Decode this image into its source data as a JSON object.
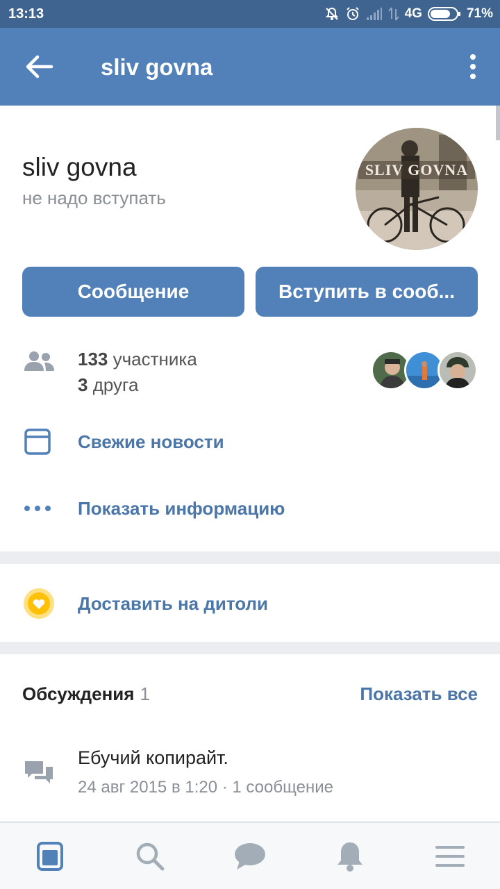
{
  "status_bar": {
    "time": "13:13",
    "network": "4G",
    "battery": "71%"
  },
  "app_bar": {
    "title": "sliv govna",
    "back_icon": "arrow-left-icon",
    "menu_icon": "more-vertical-icon"
  },
  "group": {
    "name": "sliv govna",
    "status": "не надо вступать",
    "avatar_text": "SLIV GOVNA"
  },
  "actions": {
    "message": "Сообщение",
    "join": "Вступить в сооб..."
  },
  "members": {
    "count": "133",
    "count_label": "участника",
    "friends": "3",
    "friends_label": "друга"
  },
  "links": {
    "news": "Свежие новости",
    "info": "Показать информацию"
  },
  "donate": {
    "label": "Доставить на дитоли"
  },
  "discussions": {
    "title": "Обсуждения",
    "count": "1",
    "show_all": "Показать все",
    "topic": {
      "title": "Ебучий копирайт.",
      "meta": "24 авг 2015 в 1:20 · 1 сообщение"
    }
  },
  "bottom_nav": [
    "news-icon",
    "search-icon",
    "messages-icon",
    "notifications-icon",
    "menu-icon"
  ],
  "colors": {
    "accent": "#5181b8",
    "link": "#4a76a8",
    "status_bar": "#3f648f",
    "donate": "#ffc107"
  }
}
